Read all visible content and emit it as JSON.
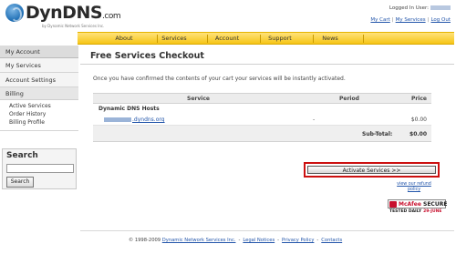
{
  "header": {
    "logo_text": "DynDNS",
    "logo_suffix": ".com",
    "logo_tagline": "by Dynamic Network Services Inc.",
    "login_label": "Logged In User:",
    "util_links": [
      "My Cart",
      "My Services",
      "Log Out"
    ]
  },
  "nav": {
    "items": [
      "About",
      "Services",
      "Account",
      "Support",
      "News"
    ]
  },
  "sidebar": {
    "header": "My Account",
    "items": [
      "My Services",
      "Account Settings"
    ],
    "billing": "Billing",
    "billing_items": [
      "Active Services",
      "Order History",
      "Billing Profile"
    ]
  },
  "search": {
    "title": "Search",
    "input_value": "",
    "button_label": "Search"
  },
  "main": {
    "title": "Free Services Checkout",
    "intro": "Once you have confirmed the contents of your cart your services will be instantly activated.",
    "table": {
      "headers": {
        "service": "Service",
        "period": "Period",
        "price": "Price"
      },
      "group": "Dynamic DNS Hosts",
      "rows": [
        {
          "host": ".dyndns.org",
          "period": "-",
          "price": "$0.00"
        }
      ],
      "subtotal_label": "Sub-Total:",
      "subtotal_value": "$0.00"
    },
    "activate_label": "Activate Services >>",
    "refund_link": "view our refund policy",
    "mcafee": {
      "brand": "McAfee",
      "secure": "SECURE",
      "tested": "TESTED DAILY",
      "date": "29-JUNE"
    }
  },
  "footer": {
    "copyright": "© 1998-2009",
    "links": [
      "Dynamic Network Services Inc.",
      "Legal Notices",
      "Privacy Policy",
      "Contacts"
    ]
  },
  "colors": {
    "nav_bg": "#f6c516",
    "link": "#2255aa",
    "highlight": "#cc1111",
    "mcafee_red": "#c8102e"
  }
}
